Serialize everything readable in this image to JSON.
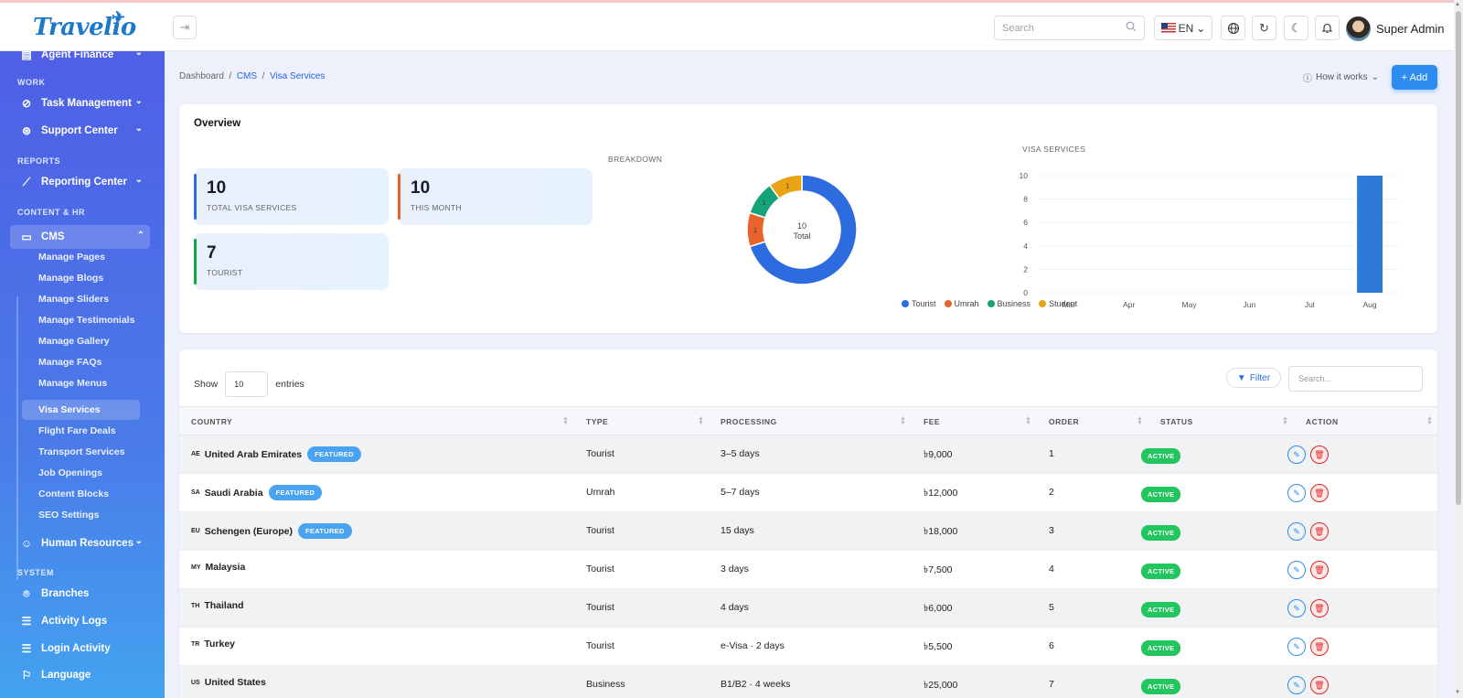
{
  "header": {
    "logo": "Travelio",
    "search_placeholder": "Search",
    "language": "EN",
    "user_name": "Super Admin"
  },
  "sidebar": {
    "top_item": "Agent Finance",
    "sections": {
      "work": "WORK",
      "reports": "REPORTS",
      "content": "CONTENT & HR",
      "system": "SYSTEM"
    },
    "items": {
      "task": "Task Management",
      "support": "Support Center",
      "reporting": "Reporting Center",
      "cms": "CMS",
      "hr": "Human Resources",
      "branches": "Branches",
      "activity": "Activity Logs",
      "login": "Login Activity",
      "language": "Language"
    },
    "cms_sub": [
      "Manage Pages",
      "Manage Blogs",
      "Manage Sliders",
      "Manage Testimonials",
      "Manage Gallery",
      "Manage FAQs",
      "Manage Menus",
      "Visa Services",
      "Flight Fare Deals",
      "Transport Services",
      "Job Openings",
      "Content Blocks",
      "SEO Settings"
    ]
  },
  "breadcrumb": {
    "dashboard": "Dashboard",
    "cms": "CMS",
    "current": "Visa Services",
    "sep": "/"
  },
  "actions": {
    "how_it_works": "How it works",
    "add": "+ Add"
  },
  "overview": {
    "title": "Overview",
    "stats": [
      {
        "value": "10",
        "label": "TOTAL VISA SERVICES",
        "color": "#2d6cdf"
      },
      {
        "value": "10",
        "label": "THIS MONTH",
        "color": "#e8622c"
      },
      {
        "value": "7",
        "label": "TOURIST",
        "color": "#16a34a"
      }
    ]
  },
  "chart_data": [
    {
      "type": "pie",
      "title": "BREAKDOWN",
      "center_value": "10",
      "center_label": "Total",
      "categories": [
        "Tourist",
        "Umrah",
        "Business",
        "Student"
      ],
      "values": [
        7,
        1,
        1,
        1
      ],
      "colors": [
        "#2d6cdf",
        "#e8622c",
        "#16a37a",
        "#e8a317"
      ]
    },
    {
      "type": "bar",
      "title": "VISA SERVICES",
      "categories": [
        "Mar",
        "Apr",
        "May",
        "Jun",
        "Jul",
        "Aug"
      ],
      "values": [
        0,
        0,
        0,
        0,
        0,
        10
      ],
      "ylim": [
        0,
        10
      ],
      "yticks": [
        "0",
        "2",
        "4",
        "6",
        "8",
        "10"
      ],
      "color": "#2d7ad8"
    }
  ],
  "table": {
    "show_label": "Show",
    "entries_value": "10",
    "entries_label": "entries",
    "filter_label": "Filter",
    "search_placeholder": "Search...",
    "columns": [
      "COUNTRY",
      "TYPE",
      "PROCESSING",
      "FEE",
      "ORDER",
      "STATUS",
      "ACTION"
    ],
    "featured_label": "FEATURED",
    "rows": [
      {
        "code": "AE",
        "country": "United Arab Emirates",
        "featured": true,
        "type": "Tourist",
        "processing": "3–5 days",
        "fee": "৳9,000",
        "order": "1",
        "status": "ACTIVE"
      },
      {
        "code": "SA",
        "country": "Saudi Arabia",
        "featured": true,
        "type": "Umrah",
        "processing": "5–7 days",
        "fee": "৳12,000",
        "order": "2",
        "status": "ACTIVE"
      },
      {
        "code": "EU",
        "country": "Schengen (Europe)",
        "featured": true,
        "type": "Tourist",
        "processing": "15 days",
        "fee": "৳18,000",
        "order": "3",
        "status": "ACTIVE"
      },
      {
        "code": "MY",
        "country": "Malaysia",
        "featured": false,
        "type": "Tourist",
        "processing": "3 days",
        "fee": "৳7,500",
        "order": "4",
        "status": "ACTIVE"
      },
      {
        "code": "TH",
        "country": "Thailand",
        "featured": false,
        "type": "Tourist",
        "processing": "4 days",
        "fee": "৳6,000",
        "order": "5",
        "status": "ACTIVE"
      },
      {
        "code": "TR",
        "country": "Turkey",
        "featured": false,
        "type": "Tourist",
        "processing": "e-Visa · 2 days",
        "fee": "৳5,500",
        "order": "6",
        "status": "ACTIVE"
      },
      {
        "code": "US",
        "country": "United States",
        "featured": false,
        "type": "Business",
        "processing": "B1/B2 · 4 weeks",
        "fee": "৳25,000",
        "order": "7",
        "status": "ACTIVE"
      }
    ]
  }
}
